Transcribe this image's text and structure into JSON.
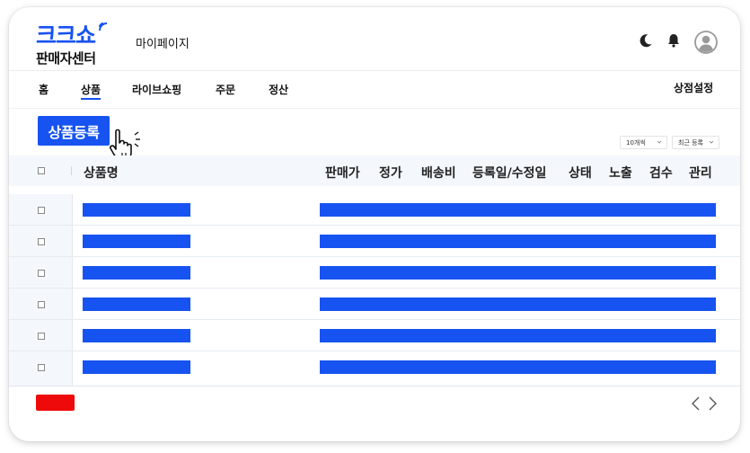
{
  "brand": {
    "logo_top": "크크쇼",
    "logo_bottom": "판매자센터",
    "accent": "#1753f0"
  },
  "header": {
    "page_title": "마이페이지",
    "icons": [
      "moon-icon",
      "bell-icon",
      "user-avatar-icon"
    ]
  },
  "nav": {
    "items": [
      {
        "label": "홈",
        "active": false
      },
      {
        "label": "상품",
        "active": true
      },
      {
        "label": "라이브쇼핑",
        "active": false
      },
      {
        "label": "주문",
        "active": false
      },
      {
        "label": "정산",
        "active": false
      }
    ],
    "store_settings": "상점설정"
  },
  "toolbar": {
    "register_label": "상품등록",
    "page_size": "10개씩",
    "sort": "최근 등록"
  },
  "table": {
    "headers": {
      "name": "상품명",
      "price": "판매가",
      "list_price": "정가",
      "shipping": "배송비",
      "dates": "등록일/수정일",
      "status": "상태",
      "exposure": "노출",
      "review": "검수",
      "manage": "관리"
    },
    "row_count": 6
  },
  "footer": {
    "delete_color": "#ee0a0a",
    "prev_icon": "chevron-left-icon",
    "next_icon": "chevron-right-icon"
  }
}
